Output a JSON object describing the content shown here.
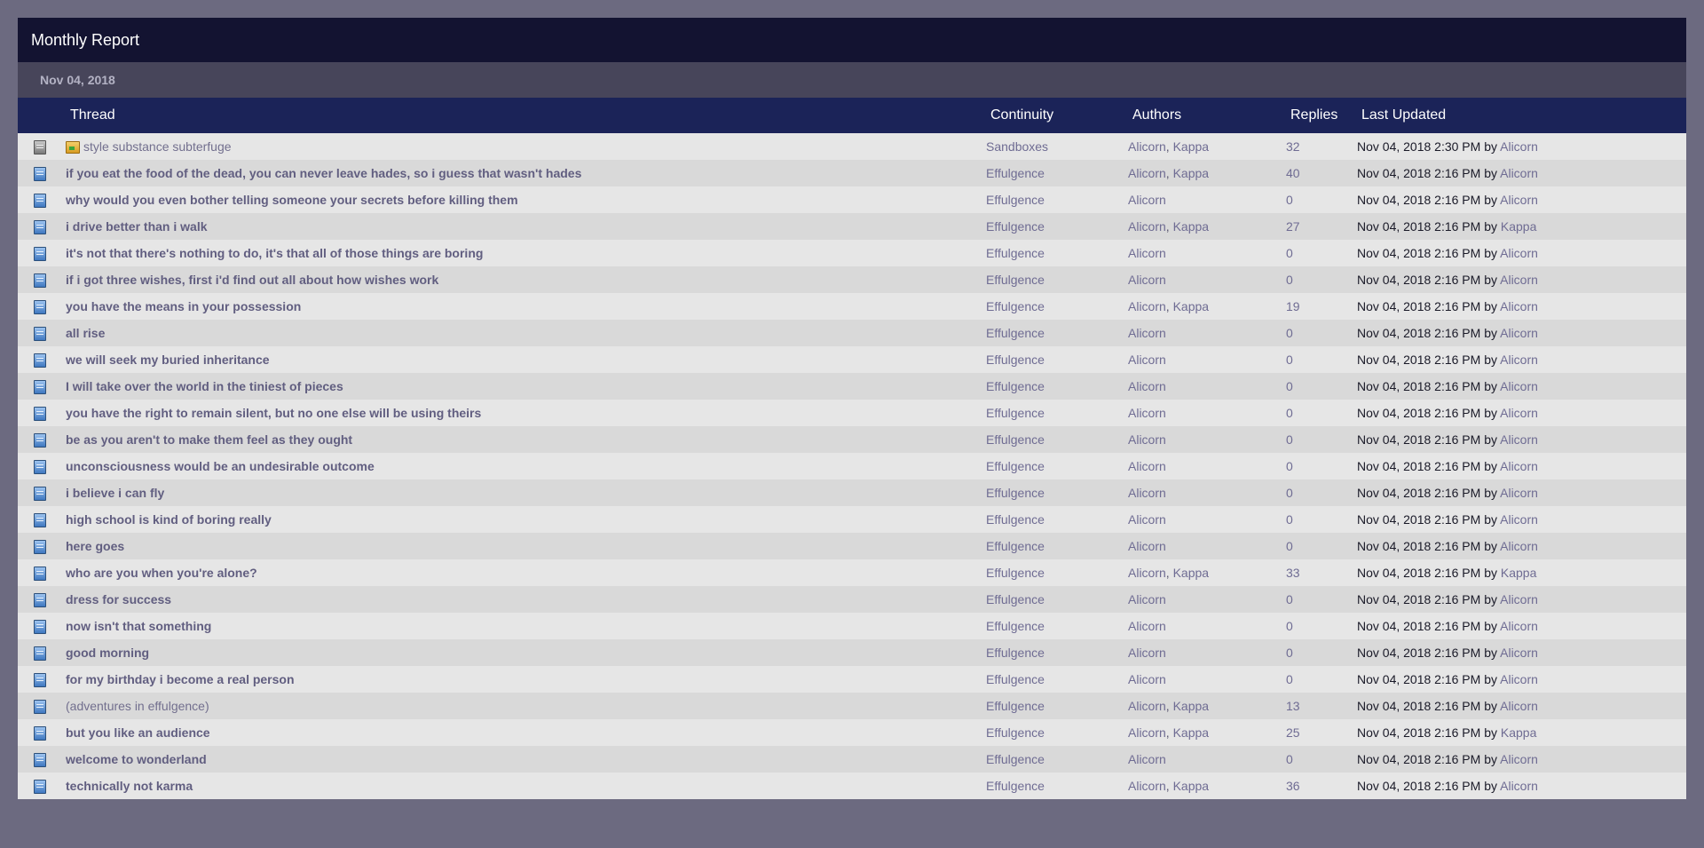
{
  "header": {
    "title": "Monthly Report",
    "date": "Nov 04, 2018"
  },
  "columns": [
    "Thread",
    "Continuity",
    "Authors",
    "Replies",
    "Last Updated"
  ],
  "by_label": "by",
  "rows": [
    {
      "icon": "thread-icon-gray",
      "moved": true,
      "title": "style substance subterfuge",
      "bold": false,
      "continuity": "Sandboxes",
      "authors": [
        "Alicorn",
        "Kappa"
      ],
      "replies": "32",
      "updated": "Nov 04, 2018 2:30 PM",
      "updated_by": "Alicorn"
    },
    {
      "icon": "thread-icon",
      "moved": false,
      "title": "if you eat the food of the dead, you can never leave hades, so i guess that wasn't hades",
      "bold": true,
      "continuity": "Effulgence",
      "authors": [
        "Alicorn",
        "Kappa"
      ],
      "replies": "40",
      "updated": "Nov 04, 2018 2:16 PM",
      "updated_by": "Alicorn"
    },
    {
      "icon": "thread-icon",
      "moved": false,
      "title": "why would you even bother telling someone your secrets before killing them",
      "bold": true,
      "continuity": "Effulgence",
      "authors": [
        "Alicorn"
      ],
      "replies": "0",
      "updated": "Nov 04, 2018 2:16 PM",
      "updated_by": "Alicorn"
    },
    {
      "icon": "thread-icon",
      "moved": false,
      "title": "i drive better than i walk",
      "bold": true,
      "continuity": "Effulgence",
      "authors": [
        "Alicorn",
        "Kappa"
      ],
      "replies": "27",
      "updated": "Nov 04, 2018 2:16 PM",
      "updated_by": "Kappa"
    },
    {
      "icon": "thread-icon",
      "moved": false,
      "title": "it's not that there's nothing to do, it's that all of those things are boring",
      "bold": true,
      "continuity": "Effulgence",
      "authors": [
        "Alicorn"
      ],
      "replies": "0",
      "updated": "Nov 04, 2018 2:16 PM",
      "updated_by": "Alicorn"
    },
    {
      "icon": "thread-icon",
      "moved": false,
      "title": "if i got three wishes, first i'd find out all about how wishes work",
      "bold": true,
      "continuity": "Effulgence",
      "authors": [
        "Alicorn"
      ],
      "replies": "0",
      "updated": "Nov 04, 2018 2:16 PM",
      "updated_by": "Alicorn"
    },
    {
      "icon": "thread-icon",
      "moved": false,
      "title": "you have the means in your possession",
      "bold": true,
      "continuity": "Effulgence",
      "authors": [
        "Alicorn",
        "Kappa"
      ],
      "replies": "19",
      "updated": "Nov 04, 2018 2:16 PM",
      "updated_by": "Alicorn"
    },
    {
      "icon": "thread-icon",
      "moved": false,
      "title": "all rise",
      "bold": true,
      "continuity": "Effulgence",
      "authors": [
        "Alicorn"
      ],
      "replies": "0",
      "updated": "Nov 04, 2018 2:16 PM",
      "updated_by": "Alicorn"
    },
    {
      "icon": "thread-icon",
      "moved": false,
      "title": "we will seek my buried inheritance",
      "bold": true,
      "continuity": "Effulgence",
      "authors": [
        "Alicorn"
      ],
      "replies": "0",
      "updated": "Nov 04, 2018 2:16 PM",
      "updated_by": "Alicorn"
    },
    {
      "icon": "thread-icon",
      "moved": false,
      "title": "I will take over the world in the tiniest of pieces",
      "bold": true,
      "continuity": "Effulgence",
      "authors": [
        "Alicorn"
      ],
      "replies": "0",
      "updated": "Nov 04, 2018 2:16 PM",
      "updated_by": "Alicorn"
    },
    {
      "icon": "thread-icon",
      "moved": false,
      "title": "you have the right to remain silent, but no one else will be using theirs",
      "bold": true,
      "continuity": "Effulgence",
      "authors": [
        "Alicorn"
      ],
      "replies": "0",
      "updated": "Nov 04, 2018 2:16 PM",
      "updated_by": "Alicorn"
    },
    {
      "icon": "thread-icon",
      "moved": false,
      "title": "be as you aren't to make them feel as they ought",
      "bold": true,
      "continuity": "Effulgence",
      "authors": [
        "Alicorn"
      ],
      "replies": "0",
      "updated": "Nov 04, 2018 2:16 PM",
      "updated_by": "Alicorn"
    },
    {
      "icon": "thread-icon",
      "moved": false,
      "title": "unconsciousness would be an undesirable outcome",
      "bold": true,
      "continuity": "Effulgence",
      "authors": [
        "Alicorn"
      ],
      "replies": "0",
      "updated": "Nov 04, 2018 2:16 PM",
      "updated_by": "Alicorn"
    },
    {
      "icon": "thread-icon",
      "moved": false,
      "title": "i believe i can fly",
      "bold": true,
      "continuity": "Effulgence",
      "authors": [
        "Alicorn"
      ],
      "replies": "0",
      "updated": "Nov 04, 2018 2:16 PM",
      "updated_by": "Alicorn"
    },
    {
      "icon": "thread-icon",
      "moved": false,
      "title": "high school is kind of boring really",
      "bold": true,
      "continuity": "Effulgence",
      "authors": [
        "Alicorn"
      ],
      "replies": "0",
      "updated": "Nov 04, 2018 2:16 PM",
      "updated_by": "Alicorn"
    },
    {
      "icon": "thread-icon",
      "moved": false,
      "title": "here goes",
      "bold": true,
      "continuity": "Effulgence",
      "authors": [
        "Alicorn"
      ],
      "replies": "0",
      "updated": "Nov 04, 2018 2:16 PM",
      "updated_by": "Alicorn"
    },
    {
      "icon": "thread-icon",
      "moved": false,
      "title": "who are you when you're alone?",
      "bold": true,
      "continuity": "Effulgence",
      "authors": [
        "Alicorn",
        "Kappa"
      ],
      "replies": "33",
      "updated": "Nov 04, 2018 2:16 PM",
      "updated_by": "Kappa"
    },
    {
      "icon": "thread-icon",
      "moved": false,
      "title": "dress for success",
      "bold": true,
      "continuity": "Effulgence",
      "authors": [
        "Alicorn"
      ],
      "replies": "0",
      "updated": "Nov 04, 2018 2:16 PM",
      "updated_by": "Alicorn"
    },
    {
      "icon": "thread-icon",
      "moved": false,
      "title": "now isn't that something",
      "bold": true,
      "continuity": "Effulgence",
      "authors": [
        "Alicorn"
      ],
      "replies": "0",
      "updated": "Nov 04, 2018 2:16 PM",
      "updated_by": "Alicorn"
    },
    {
      "icon": "thread-icon",
      "moved": false,
      "title": "good morning",
      "bold": true,
      "continuity": "Effulgence",
      "authors": [
        "Alicorn"
      ],
      "replies": "0",
      "updated": "Nov 04, 2018 2:16 PM",
      "updated_by": "Alicorn"
    },
    {
      "icon": "thread-icon",
      "moved": false,
      "title": "for my birthday i become a real person",
      "bold": true,
      "continuity": "Effulgence",
      "authors": [
        "Alicorn"
      ],
      "replies": "0",
      "updated": "Nov 04, 2018 2:16 PM",
      "updated_by": "Alicorn"
    },
    {
      "icon": "thread-icon",
      "moved": false,
      "title": "(adventures in effulgence)",
      "bold": false,
      "continuity": "Effulgence",
      "authors": [
        "Alicorn",
        "Kappa"
      ],
      "replies": "13",
      "updated": "Nov 04, 2018 2:16 PM",
      "updated_by": "Alicorn"
    },
    {
      "icon": "thread-icon",
      "moved": false,
      "title": "but you like an audience",
      "bold": true,
      "continuity": "Effulgence",
      "authors": [
        "Alicorn",
        "Kappa"
      ],
      "replies": "25",
      "updated": "Nov 04, 2018 2:16 PM",
      "updated_by": "Kappa"
    },
    {
      "icon": "thread-icon",
      "moved": false,
      "title": "welcome to wonderland",
      "bold": true,
      "continuity": "Effulgence",
      "authors": [
        "Alicorn"
      ],
      "replies": "0",
      "updated": "Nov 04, 2018 2:16 PM",
      "updated_by": "Alicorn"
    },
    {
      "icon": "thread-icon",
      "moved": false,
      "title": "technically not karma",
      "bold": true,
      "continuity": "Effulgence",
      "authors": [
        "Alicorn",
        "Kappa"
      ],
      "replies": "36",
      "updated": "Nov 04, 2018 2:16 PM",
      "updated_by": "Alicorn"
    }
  ]
}
